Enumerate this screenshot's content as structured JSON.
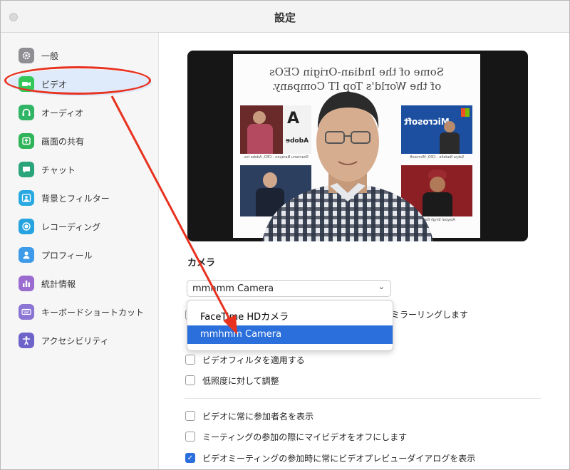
{
  "window": {
    "title": "設定"
  },
  "sidebar": {
    "items": [
      {
        "label": "一般",
        "icon": "gear-icon",
        "color": "#8e8e93"
      },
      {
        "label": "ビデオ",
        "icon": "video-camera-icon",
        "color": "#34c759"
      },
      {
        "label": "オーディオ",
        "icon": "headphones-icon",
        "color": "#30b566"
      },
      {
        "label": "画面の共有",
        "icon": "share-screen-icon",
        "color": "#2fb45a"
      },
      {
        "label": "チャット",
        "icon": "chat-bubble-icon",
        "color": "#2aa47a"
      },
      {
        "label": "背景とフィルター",
        "icon": "background-person-icon",
        "color": "#29a9e1"
      },
      {
        "label": "レコーディング",
        "icon": "record-icon",
        "color": "#27a3e0"
      },
      {
        "label": "プロフィール",
        "icon": "profile-icon",
        "color": "#3d9be9"
      },
      {
        "label": "統計情報",
        "icon": "statistics-icon",
        "color": "#9b6ccf"
      },
      {
        "label": "キーボードショートカット",
        "icon": "keyboard-icon",
        "color": "#8a74d4"
      },
      {
        "label": "アクセシビリティ",
        "icon": "accessibility-icon",
        "color": "#6d63c9"
      }
    ],
    "selected_index": 1
  },
  "preview": {
    "slide_title_line1": "Some of the Indian-Origin CEOs",
    "slide_title_line2": "of the World's Top IT Company.",
    "slide_logo_text": "Microsoft",
    "slide_logo_text2": "Adobe",
    "captions": [
      "Shantanu Narayen - CEO, Adobe Inc.",
      "Satya Nadella - CEO, Microsoft",
      "Ajaypal Singh Banga"
    ]
  },
  "camera": {
    "section_label": "カメラ",
    "selected": "mmhmm Camera",
    "options": [
      "FaceTime HDカメラ",
      "mmhmm Camera"
    ],
    "selected_option_index": 1,
    "mirror_partial_label": "ミラーリングします"
  },
  "options": [
    {
      "label": "ビデオフィルタを適用する",
      "checked": false
    },
    {
      "label": "低照度に対して調整",
      "checked": false
    },
    {
      "label": "ビデオに常に参加者名を表示",
      "checked": false
    },
    {
      "label": "ミーティングの参加の際にマイビデオをオフにします",
      "checked": false
    },
    {
      "label": "ビデオミーティングの参加時に常にビデオプレビューダイアログを表示",
      "checked": true
    }
  ],
  "annotation_color": "#e8321f",
  "accent_color": "#2a6fdb"
}
